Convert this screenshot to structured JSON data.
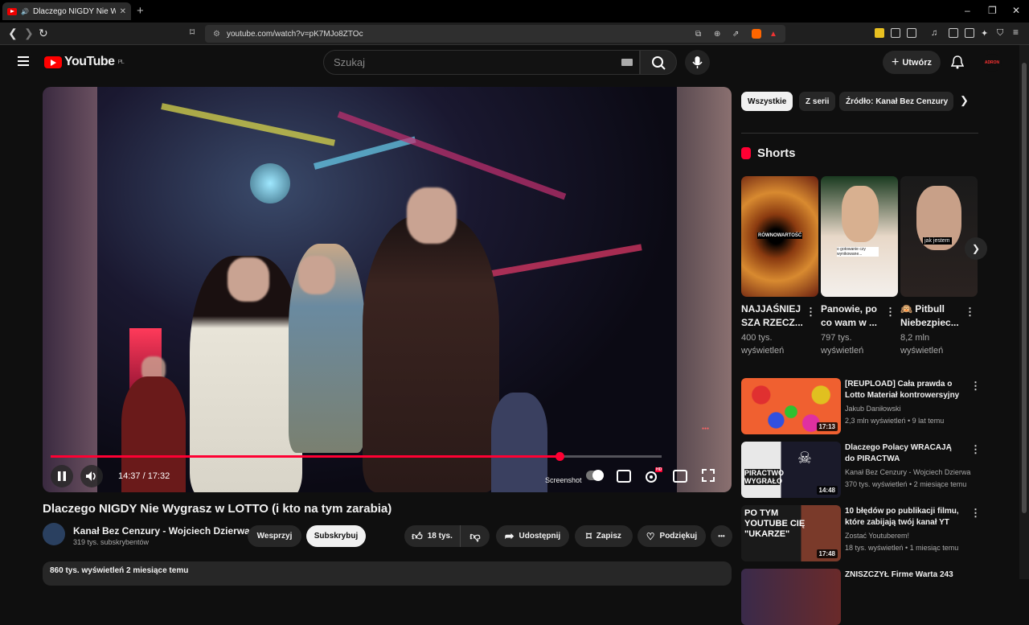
{
  "browser": {
    "tab_title": "Dlaczego NIGDY Nie Wygrasz w LOTTO",
    "new_tab": "+",
    "url": "youtube.com/watch?v=pK7MJo8ZTOc",
    "win_min": "–",
    "win_max": "❐",
    "win_close": "✕"
  },
  "header": {
    "logo_text": "YouTube",
    "region": "PL",
    "search_placeholder": "Szukaj",
    "create_label": "Utwórz",
    "avatar_text": "ADRON"
  },
  "player": {
    "time": "14:37 / 17:32",
    "progress_fraction": 0.833,
    "screenshot_label": "Screenshot",
    "hd_badge": "HD"
  },
  "video": {
    "title": "Dlaczego NIGDY Nie Wygrasz w LOTTO (i kto na tym zarabia)",
    "channel": "Kanał Bez Cenzury - Wojciech Dzierwa",
    "subscribers": "319 tys. subskrybentów",
    "join": "Wesprzyj",
    "subscribe": "Subskrybuj",
    "likes": "18 tys.",
    "share": "Udostępnij",
    "save": "Zapisz",
    "thanks": "Podziękuj",
    "more": "•••",
    "stats": "860 tys. wyświetleń  2 miesiące temu"
  },
  "chips": [
    "Wszystkie",
    "Z serii",
    "Źródło: Kanał Bez Cenzury"
  ],
  "shorts": {
    "heading": "Shorts",
    "items": [
      {
        "title": "NAJJAŚNIEJ SZA RZECZ...",
        "views": "400 tys. wyświetleń",
        "overlay": "RÓWNOWARTOŚĆ"
      },
      {
        "title": "Panowie, po co wam w ...",
        "views": "797 tys. wyświetleń",
        "overlay": "o gotowanie czy wynikowane..."
      },
      {
        "title": "🙉 Pitbull Niebezpiec...",
        "views": "8,2 mln wyświetleń",
        "overlay": "jak jestem"
      }
    ]
  },
  "recommended": [
    {
      "title": "[REUPLOAD] Cała prawda o Lotto  Materiał kontrowersyjny",
      "channel": "Jakub Daniłowski",
      "meta": "2,3 mln wyświetleń • 9 lat temu",
      "duration": "17:13"
    },
    {
      "title": "Dlaczego Polacy WRACAJĄ do PIRACTWA",
      "channel": "Kanał Bez Cenzury - Wojciech Dzierwa",
      "meta": "370 tys. wyświetleń • 2 miesiące temu",
      "duration": "14:48",
      "thumb_text": "PIRACTWO WYGRAŁO"
    },
    {
      "title": "10 błędów po publikacji filmu, które zabijają twój kanał YT",
      "channel": "Zostać Youtuberem!",
      "meta": "18 tys. wyświetleń • 1 miesiąc temu",
      "duration": "17:48",
      "thumb_text": "PO TYM YOUTUBE CIĘ \"UKARZE\""
    },
    {
      "title": "ZNISZCZYŁ Firme Warta 243",
      "channel": "",
      "meta": "",
      "duration": ""
    }
  ]
}
